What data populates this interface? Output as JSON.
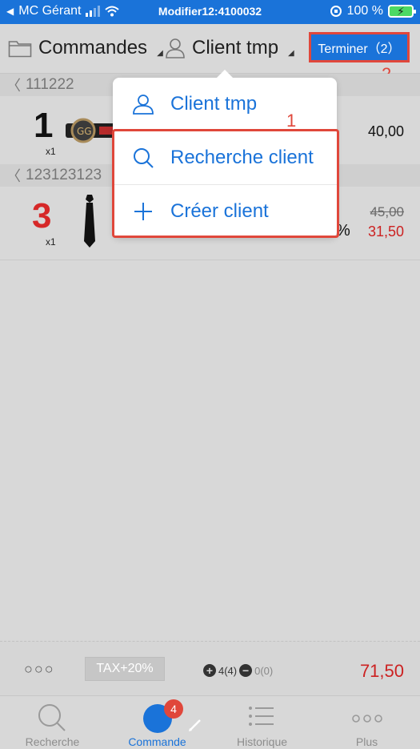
{
  "status_bar": {
    "carrier": "MC Gérant",
    "center_text": "Modifier12:4100032",
    "battery_text": "100 %"
  },
  "toolbar": {
    "category_label": "Commandes",
    "client_label": "Client tmp",
    "finish_label": "Terminer（2）"
  },
  "annotations": {
    "first": "1",
    "second": "2"
  },
  "groups": [
    {
      "label": "111222"
    },
    {
      "label": "123123123"
    }
  ],
  "orders": [
    {
      "qty": "1",
      "qty_sub": "x1",
      "price": "40,00"
    },
    {
      "qty": "3",
      "qty_sub": "x1",
      "partial_text": "%",
      "old_price": "45,00",
      "new_price": "31,50"
    }
  ],
  "client_menu": {
    "items": [
      {
        "label": "Client tmp",
        "icon": "user-icon"
      },
      {
        "label": "Recherche client",
        "icon": "search-icon"
      },
      {
        "label": "Créer client",
        "icon": "plus-icon"
      }
    ]
  },
  "summary": {
    "dots": "○○○",
    "tax_label": "TAX+20%",
    "plus_count": "4(4)",
    "minus_count": "0(0)",
    "total": "71,50"
  },
  "tabs": [
    {
      "label": "Recherche",
      "icon": "search-icon"
    },
    {
      "label": "Commande",
      "icon": "edit-icon",
      "badge": "4"
    },
    {
      "label": "Historique",
      "icon": "list-icon"
    },
    {
      "label": "Plus",
      "icon": "more-icon"
    }
  ],
  "colors": {
    "accent": "#1a73d9",
    "alert": "#e0473b",
    "price_red": "#cc2222"
  }
}
